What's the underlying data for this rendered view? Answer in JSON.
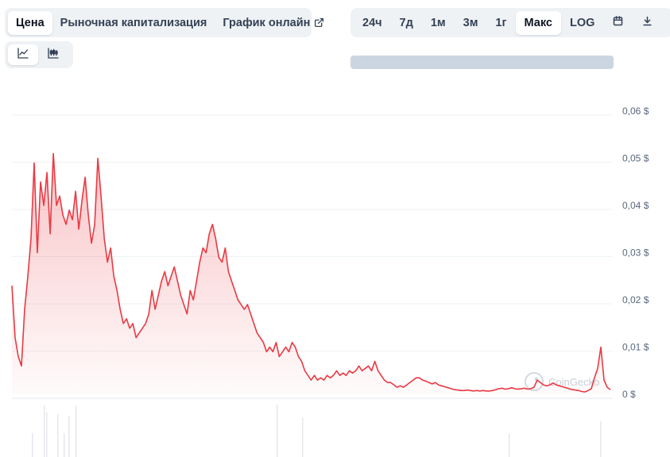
{
  "tabs": {
    "metric": [
      "Цена",
      "Рыночная капитализация",
      "График онлайн"
    ],
    "ranges": [
      "24ч",
      "7д",
      "1м",
      "3м",
      "1г",
      "Макс",
      "LOG"
    ]
  },
  "icons": {
    "external_link": "external-link-icon",
    "line_chart": "line-chart-icon",
    "candlestick": "candlestick-icon",
    "calendar": "calendar-icon",
    "download": "download-icon"
  },
  "watermark": "CoinGecko",
  "colors": {
    "line": "#ea3943",
    "accent_bg": "#eff2f5",
    "grid": "#eff2f5"
  },
  "chart_data": {
    "type": "area",
    "title": "",
    "xlabel": "",
    "ylabel": "",
    "ylim": [
      0,
      0.06
    ],
    "yticks": [
      0,
      0.01,
      0.02,
      0.03,
      0.04,
      0.05,
      0.06
    ],
    "ytick_labels": [
      "0 $",
      "0,01 $",
      "0,02 $",
      "0,03 $",
      "0,04 $",
      "0,05 $",
      "0,06 $"
    ],
    "grid": true,
    "series": [
      {
        "values": [
          0.023,
          0.012,
          0.008,
          0.006,
          0.018,
          0.025,
          0.033,
          0.049,
          0.03,
          0.045,
          0.04,
          0.047,
          0.034,
          0.051,
          0.04,
          0.042,
          0.038,
          0.036,
          0.039,
          0.037,
          0.043,
          0.035,
          0.041,
          0.046,
          0.038,
          0.032,
          0.036,
          0.05,
          0.042,
          0.033,
          0.028,
          0.031,
          0.025,
          0.022,
          0.018,
          0.015,
          0.016,
          0.014,
          0.015,
          0.012,
          0.013,
          0.014,
          0.015,
          0.017,
          0.022,
          0.018,
          0.021,
          0.024,
          0.026,
          0.023,
          0.025,
          0.027,
          0.024,
          0.021,
          0.019,
          0.017,
          0.022,
          0.02,
          0.024,
          0.028,
          0.031,
          0.03,
          0.034,
          0.036,
          0.033,
          0.029,
          0.028,
          0.031,
          0.026,
          0.024,
          0.022,
          0.02,
          0.019,
          0.018,
          0.019,
          0.017,
          0.015,
          0.013,
          0.012,
          0.011,
          0.009,
          0.01,
          0.009,
          0.011,
          0.008,
          0.009,
          0.01,
          0.009,
          0.011,
          0.01,
          0.008,
          0.007,
          0.005,
          0.004,
          0.003,
          0.004,
          0.003,
          0.0035,
          0.003,
          0.004,
          0.0035,
          0.004,
          0.005,
          0.004,
          0.0045,
          0.004,
          0.005,
          0.0045,
          0.005,
          0.006,
          0.005,
          0.0055,
          0.006,
          0.005,
          0.007,
          0.005,
          0.004,
          0.003,
          0.0025,
          0.0025,
          0.002,
          0.0015,
          0.0018,
          0.0015,
          0.002,
          0.0025,
          0.003,
          0.0035,
          0.0035,
          0.003,
          0.0028,
          0.0025,
          0.0022,
          0.0025,
          0.002,
          0.0018,
          0.0016,
          0.0014,
          0.0012,
          0.001,
          0.0009,
          0.0008,
          0.0008,
          0.0009,
          0.0008,
          0.0007,
          0.0008,
          0.0007,
          0.0008,
          0.0007,
          0.0007,
          0.0008,
          0.001,
          0.0012,
          0.0013,
          0.0011,
          0.0012,
          0.0014,
          0.0012,
          0.0011,
          0.0012,
          0.0013,
          0.0011,
          0.0012,
          0.0015,
          0.003,
          0.0025,
          0.002,
          0.0018,
          0.002,
          0.0024,
          0.002,
          0.0018,
          0.0016,
          0.0014,
          0.0012,
          0.001,
          0.0009,
          0.0008,
          0.0006,
          0.0005,
          0.0008,
          0.0012,
          0.0035,
          0.0055,
          0.01,
          0.003,
          0.0015,
          0.001
        ]
      }
    ]
  }
}
